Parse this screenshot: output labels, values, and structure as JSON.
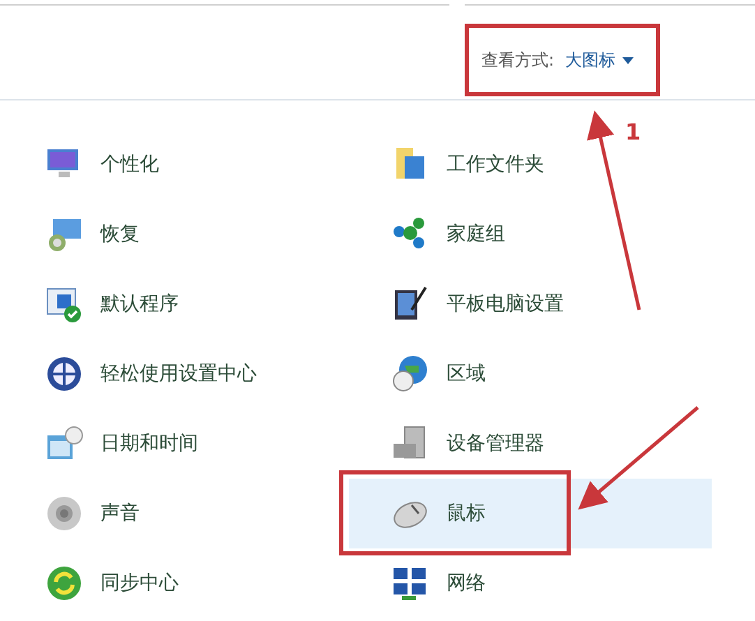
{
  "view_by": {
    "label": "查看方式:",
    "value": "大图标"
  },
  "columns": [
    {
      "items": [
        {
          "label": "个性化",
          "selected": false
        },
        {
          "label": "恢复",
          "selected": false
        },
        {
          "label": "默认程序",
          "selected": false
        },
        {
          "label": "轻松使用设置中心",
          "selected": false
        },
        {
          "label": "日期和时间",
          "selected": false
        },
        {
          "label": "声音",
          "selected": false
        },
        {
          "label": "同步中心",
          "selected": false
        }
      ]
    },
    {
      "items": [
        {
          "label": "工作文件夹",
          "selected": false
        },
        {
          "label": "家庭组",
          "selected": false
        },
        {
          "label": "平板电脑设置",
          "selected": false
        },
        {
          "label": "区域",
          "selected": false
        },
        {
          "label": "设备管理器",
          "selected": false
        },
        {
          "label": "鼠标",
          "selected": true
        },
        {
          "label": "网络",
          "selected": false
        }
      ]
    }
  ],
  "annotation": {
    "step_label": "1"
  }
}
